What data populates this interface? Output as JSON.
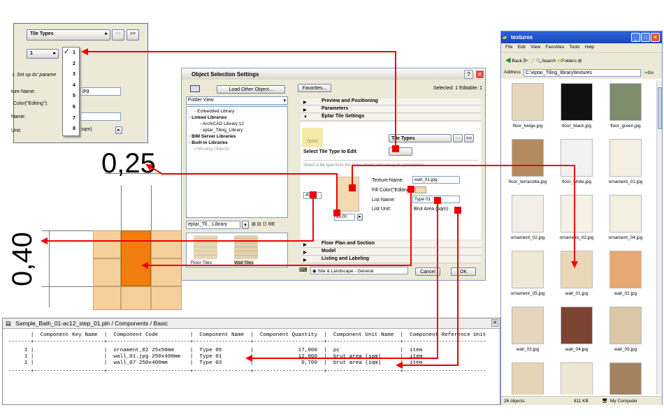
{
  "big_labels": {
    "width": "0,25",
    "height": "0,40"
  },
  "popup": {
    "dropdown_label": "Tile Types",
    "prev_btn": "<<",
    "next_btn": ">>",
    "index_value": "1",
    "menu_items": [
      "1",
      "2",
      "3",
      "4",
      "5",
      "6",
      "7",
      "8"
    ],
    "checked_index": 0,
    "setup_text": "r. Set up its' parame",
    "fields": [
      {
        "label": "ture Name:",
        "value": "jpg"
      },
      {
        "label": "Color(\"Editing\"):",
        "value": ""
      },
      {
        "label": "Name:",
        "value": ""
      },
      {
        "label": "Unit:",
        "value": "a (sqm)"
      }
    ]
  },
  "dialog": {
    "title": "Object Selection Settings",
    "load_other": "Load Other Object...",
    "favorites": "Favorites...",
    "selected_info": "Selected: 1 Editable: 1",
    "folder_view": "Folder View",
    "tree": [
      {
        "label": "Embedded Library",
        "bold": false,
        "indent": 1
      },
      {
        "label": "Linked Libraries",
        "bold": true,
        "indent": 0
      },
      {
        "label": "ArchiCAD Library 12",
        "bold": false,
        "indent": 2
      },
      {
        "label": "eptar_Tiling_Library",
        "bold": false,
        "indent": 2
      },
      {
        "label": "BIM Server Libraries",
        "bold": true,
        "indent": 0
      },
      {
        "label": "Built-in Libraries",
        "bold": true,
        "indent": 0
      },
      {
        "label": "Missing Objects",
        "bold": false,
        "indent": 1
      }
    ],
    "lib_path": "eptar_Til....Library",
    "preview_captions": [
      "Floor Tiles",
      "Wall Tiles"
    ],
    "sections_top": [
      "Preview and Positioning",
      "Parameters",
      "Éptar Tile Settings"
    ],
    "logo": "éptár",
    "tile_types": "Tile Types",
    "select_type_label": "Select Tile Type to Edit",
    "instruction": "Select a tile type from the menu above and set up its' parameters",
    "size_value": "25,00",
    "size_value2": "40,00",
    "texture_name_label": "Texture Name:",
    "texture_name_value": "wall_01.jpg",
    "fill_color_label": "Fill Color(\"Editing\"):",
    "list_name_label": "List Name:",
    "list_name_value": "Type 01",
    "list_unit_label": "List Unit:",
    "list_unit_value": "Brut Area (sqm)",
    "sections_bottom": [
      "Floor Plan and Section",
      "Model",
      "Listing and Labeling"
    ],
    "layer": "Site & Landscape - General",
    "cancel": "Cancel",
    "ok": "OK"
  },
  "explorer": {
    "title": "textures",
    "menu": [
      "File",
      "Edit",
      "View",
      "Favorites",
      "Tools",
      "Help"
    ],
    "back": "Back",
    "search": "Search",
    "folders": "Folders",
    "address_label": "Address",
    "address": "C:\\eptar_Tiling_library\\textures",
    "go": "Go",
    "files": [
      {
        "name": "floor_beige.jpg",
        "color": "#e2d6bd"
      },
      {
        "name": "floor_black.jpg",
        "color": "#111111"
      },
      {
        "name": "floor_green.jpg",
        "color": "#7d8c6a"
      },
      {
        "name": "floor_terracotta.jpg",
        "color": "#b58a5f"
      },
      {
        "name": "floor_white.jpg",
        "color": "#f2f2f2"
      },
      {
        "name": "ornament_01.jpg",
        "color": "#f5efe3"
      },
      {
        "name": "ornament_02.jpg",
        "color": "#f4efe6"
      },
      {
        "name": "ornament_03.jpg",
        "color": "#f5f1e6"
      },
      {
        "name": "ornament_04.jpg",
        "color": "#f3efe1"
      },
      {
        "name": "ornament_05.jpg",
        "color": "#f0e8d7"
      },
      {
        "name": "wall_01.jpg",
        "color": "#ead7b8"
      },
      {
        "name": "wall_02.jpg",
        "color": "#e8a872"
      },
      {
        "name": "wall_03.jpg",
        "color": "#e4d5bd"
      },
      {
        "name": "wall_04.jpg",
        "color": "#7b4432"
      },
      {
        "name": "wall_05.jpg",
        "color": "#dcc7a9"
      },
      {
        "name": "",
        "color": "#e7d3b6"
      },
      {
        "name": "",
        "color": "#eee5d3"
      },
      {
        "name": "",
        "color": "#a3835f"
      }
    ],
    "status_count": "26 objects",
    "status_size": "811 KB",
    "status_location": "My Computer"
  },
  "components": {
    "title": "Sample_Bath_01-ac12_step_01.pln / Components / Basic",
    "header": "       |  Component Key Name  |  Component Code          |  Component Name  |  Component Quantity  |  Component Unit Name  |  Component Reference Unit",
    "separator": "-------+----------------------+--------------------------+------------------+----------------------+-----------------------+--------------------------",
    "rows": [
      "     1 |                      |  ornament_02 25x50mm     |  Type 05         |              17,000  |  pc                   |  item",
      "     1 |                      |  wall_01.jpg 250x400mm   |  Type 01         |              12,000  |  brut area (sqm)      |  item",
      "     1 |                      |  wall_07 250x400mm       |  Type 03         |               0,700  |  brut area (sqm)      |  item"
    ],
    "footer": "-------+----------------------+--------------------------+------------------+----------------------+-----------------------+--------------------------"
  },
  "colors": {
    "arrow": "#ee0000",
    "accent_tile": "#f07d0d",
    "tile": "#f5cf9c"
  }
}
